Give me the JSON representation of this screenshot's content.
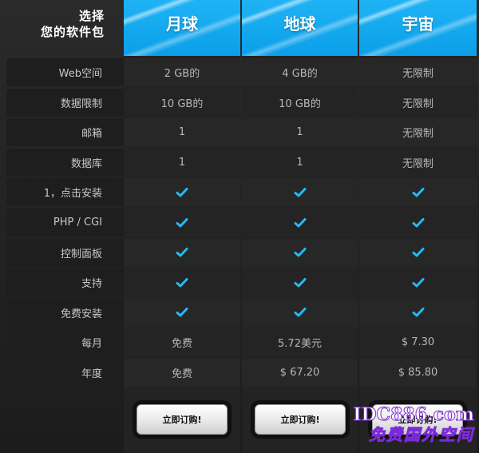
{
  "title": [
    "选择",
    "您的软件包"
  ],
  "plans": [
    {
      "name": "月球",
      "button": "立即订购!"
    },
    {
      "name": "地球",
      "button": "立即订购!"
    },
    {
      "name": "宇宙",
      "button": "立即订购!"
    }
  ],
  "rows": [
    {
      "label": "Web空间",
      "values": [
        "2 GB的",
        "4 GB的",
        "无限制"
      ]
    },
    {
      "label": "数据限制",
      "values": [
        "10 GB的",
        "10 GB的",
        "无限制"
      ]
    },
    {
      "label": "邮箱",
      "values": [
        "1",
        "1",
        "无限制"
      ]
    },
    {
      "label": "数据库",
      "values": [
        "1",
        "1",
        "无限制"
      ]
    },
    {
      "label": "1，点击安装",
      "values": [
        "✓",
        "✓",
        "✓"
      ]
    },
    {
      "label": "PHP / CGI",
      "values": [
        "✓",
        "✓",
        "✓"
      ]
    },
    {
      "label": "控制面板",
      "values": [
        "✓",
        "✓",
        "✓"
      ]
    },
    {
      "label": "支持",
      "values": [
        "✓",
        "✓",
        "✓"
      ]
    },
    {
      "label": "免费安装",
      "values": [
        "✓",
        "✓",
        "✓"
      ]
    },
    {
      "label": "每月",
      "values": [
        "免费",
        "5.72美元",
        "$ 7.30"
      ]
    },
    {
      "label": "年度",
      "values": [
        "免费",
        "$ 67.20",
        "$ 85.80"
      ]
    }
  ],
  "watermark": {
    "line1": "IDC886.com",
    "line2": "免费国外空间"
  },
  "colors": {
    "accent": "#0ea5ee",
    "check": "#29b8f0",
    "background": "#1f1f1f"
  }
}
